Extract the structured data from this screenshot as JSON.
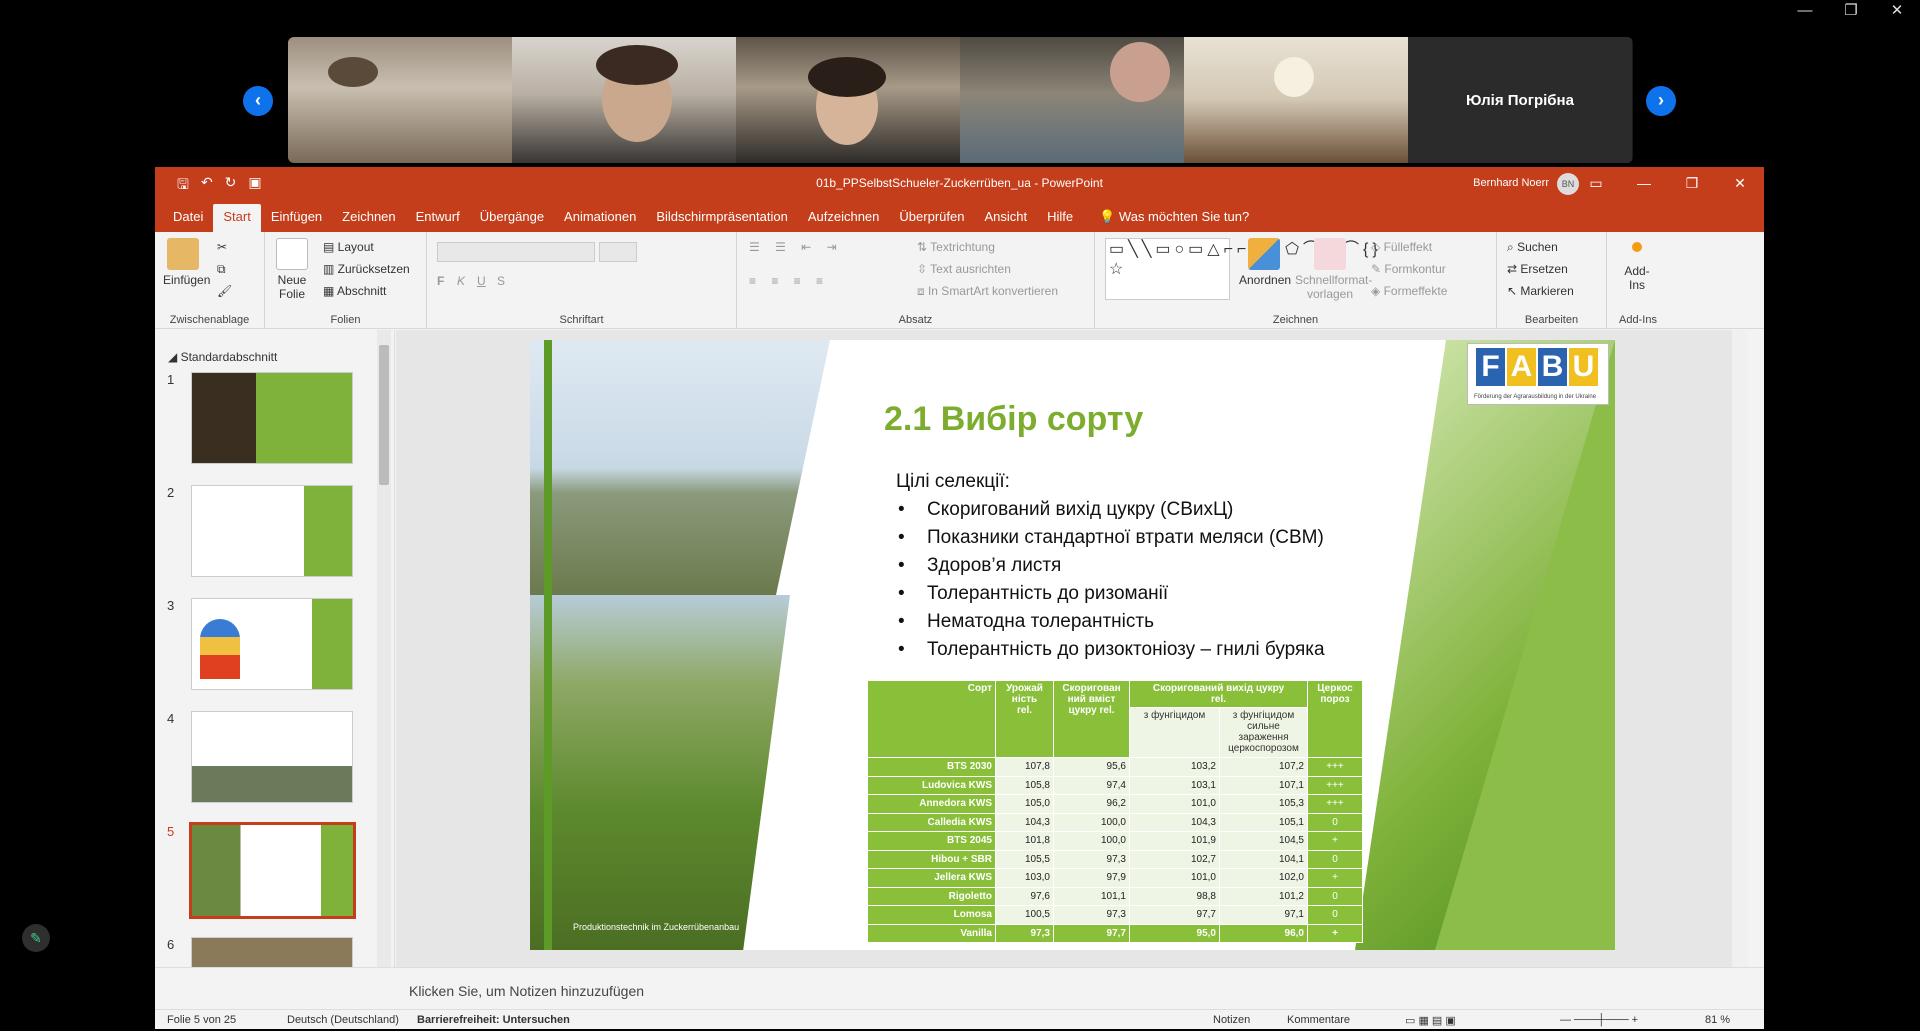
{
  "window_controls": {
    "minimize": "—",
    "restore": "❐",
    "close": "✕"
  },
  "gallery": {
    "participants": [
      "",
      "",
      "",
      "",
      "",
      "Юлія Погрібна"
    ],
    "prev_icon": "‹",
    "next_icon": "›"
  },
  "powerpoint": {
    "doc_title": "01b_PPSelbstSchueler-Zuckerrüben_ua  -  PowerPoint",
    "user_name": "Bernhard Noerr",
    "user_initials": "BN",
    "qat": {
      "save": "🖫",
      "undo": "↶",
      "redo": "↻",
      "present": "▣"
    },
    "tabs": [
      "Datei",
      "Start",
      "Einfügen",
      "Zeichnen",
      "Entwurf",
      "Übergänge",
      "Animationen",
      "Bildschirmpräsentation",
      "Aufzeichnen",
      "Überprüfen",
      "Ansicht",
      "Hilfe"
    ],
    "active_tab": "Start",
    "tell_me": "Was möchten Sie tun?",
    "ribbon": {
      "clipboard": {
        "paste": "Einfügen",
        "label": "Zwischenablage"
      },
      "slides": {
        "new_slide": "Neue\nFolie",
        "layout": "Layout",
        "reset": "Zurücksetzen",
        "section": "Abschnitt",
        "label": "Folien"
      },
      "font": {
        "bold": "F",
        "italic": "K",
        "underline": "U",
        "strike": "S",
        "label": "Schriftart"
      },
      "paragraph": {
        "text_direction": "Textrichtung",
        "align_text": "Text ausrichten",
        "smartart": "In SmartArt konvertieren",
        "label": "Absatz"
      },
      "drawing": {
        "arrange": "Anordnen",
        "quick_styles": "Schnellformat-\nvorlagen",
        "fill": "Fülleffekt",
        "outline": "Formkontur",
        "effects": "Formeffekte",
        "label": "Zeichnen"
      },
      "editing": {
        "find": "Suchen",
        "replace": "Ersetzen",
        "select": "Markieren",
        "label": "Bearbeiten"
      },
      "addins": {
        "button": "Add-\nIns",
        "label": "Add-Ins"
      }
    },
    "thumbs": {
      "section": "Standardabschnitt",
      "numbers": [
        "1",
        "2",
        "3",
        "4",
        "5",
        "6"
      ],
      "selected_index": 4
    },
    "slide": {
      "title": "2.1 Вибір сорту",
      "goals_heading": "Цілі селекції:",
      "goals": [
        "Скоригований вихід цукру (СВиxЦ)",
        "Показники стандартної втрати меляси (СВМ)",
        "Здоров’я листя",
        "Толерантність до ризоманії",
        "Нематодна толерантність",
        "Толерантність до ризоктоніозу – гнилі буряка"
      ],
      "caption": "Produktionstechnik im Zuckerrübenanbau",
      "logo_letters": [
        "F",
        "A",
        "B",
        "U"
      ],
      "logo_sub": "Förderung der Agrarausbildung in der Ukraine",
      "table": {
        "headers": [
          "Сорт",
          "Урожай\nність\nrel.",
          "Скоригован\nний вміст\nцукру rel.",
          "Скоригований вихід цукру\nrel.",
          "Церкос\nпороз"
        ],
        "subheaders": [
          "з фунгіцидом",
          "з фунгіцидом\nсильне\nзараження\nцеркоспорозом"
        ],
        "rows": [
          [
            "BTS 2030",
            "107,8",
            "95,6",
            "103,2",
            "107,2",
            "+++"
          ],
          [
            "Ludovica KWS",
            "105,8",
            "97,4",
            "103,1",
            "107,1",
            "+++"
          ],
          [
            "Annedora KWS",
            "105,0",
            "96,2",
            "101,0",
            "105,3",
            "+++"
          ],
          [
            "Calledia KWS",
            "104,3",
            "100,0",
            "104,3",
            "105,1",
            "0"
          ],
          [
            "BTS 2045",
            "101,8",
            "100,0",
            "101,9",
            "104,5",
            "+"
          ],
          [
            "Hibou + SBR",
            "105,5",
            "97,3",
            "102,7",
            "104,1",
            "0"
          ],
          [
            "Jellera KWS",
            "103,0",
            "97,9",
            "101,0",
            "102,0",
            "+"
          ],
          [
            "Rigoletto",
            "97,6",
            "101,1",
            "98,8",
            "101,2",
            "0"
          ],
          [
            "Lomosa",
            "100,5",
            "97,3",
            "97,7",
            "97,1",
            "0"
          ],
          [
            "Vanilla",
            "97,3",
            "97,7",
            "95,0",
            "96,0",
            "+"
          ]
        ]
      }
    },
    "notes_placeholder": "Klicken Sie, um Notizen hinzuzufügen",
    "status": {
      "slide_of": "Folie 5 von 25",
      "language": "Deutsch (Deutschland)",
      "accessibility": "Barrierefreiheit: Untersuchen",
      "notes": "Notizen",
      "comments": "Kommentare",
      "zoom": "81 %"
    },
    "colors": {
      "accent": "#c43e1c",
      "slide_green": "#8abf3a",
      "title_green": "#7cad2e"
    }
  },
  "pen_icon": "✎"
}
